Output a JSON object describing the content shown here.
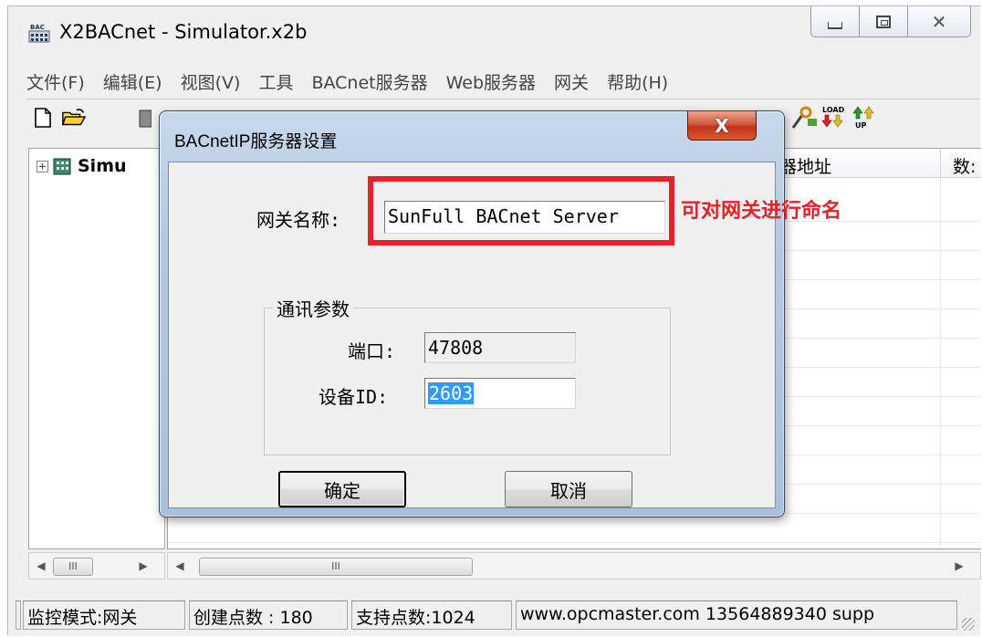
{
  "window": {
    "title": "X2BACnet - Simulator.x2b",
    "app_icon": "bac-app-icon"
  },
  "menu": {
    "items": [
      "文件(F)",
      "编辑(E)",
      "视图(V)",
      "工具",
      "BACnet服务器",
      "Web服务器",
      "网关",
      "帮助(H)"
    ]
  },
  "toolbar": {
    "icons": [
      "new-file-icon",
      "open-folder-icon",
      "save-icon",
      "load-icon",
      "upload-icon"
    ],
    "load_text": "LOAD",
    "up_text": "UP"
  },
  "tree": {
    "root_label": "Simu",
    "expander": "+"
  },
  "list": {
    "columns": [
      "器地址",
      "数:"
    ]
  },
  "dialog": {
    "title": "BACnetIP服务器设置",
    "close_glyph": "X",
    "gateway_name_label": "网关名称:",
    "gateway_name_value": "SunFull BACnet Server",
    "group_label": "通讯参数",
    "port_label": "端口:",
    "port_value": "47808",
    "device_id_label": "设备ID:",
    "device_id_value": "2603",
    "ok_label": "确定",
    "cancel_label": "取消"
  },
  "annotation": {
    "text": "可对网关进行命名",
    "color": "#e8202a"
  },
  "scrollbar": {
    "thumb_grip": "III"
  },
  "status": {
    "mode": "监控模式:网关",
    "created_points": "创建点数 : 180",
    "supported_points": "支持点数:1024",
    "info": "www.opcmaster.com 13564889340 supp"
  }
}
